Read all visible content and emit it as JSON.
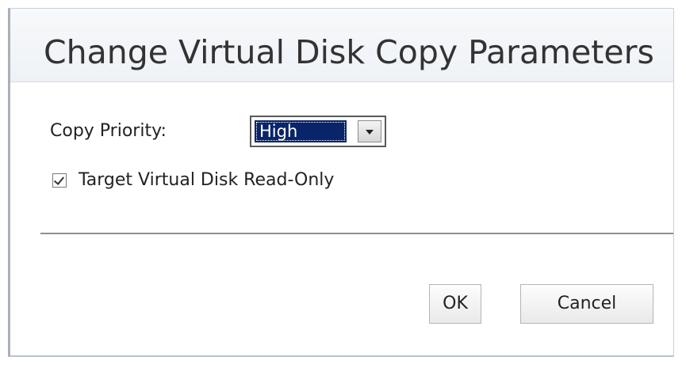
{
  "dialog": {
    "title": "Change Virtual Disk Copy Parameters"
  },
  "form": {
    "copy_priority_label": "Copy Priority:",
    "copy_priority_value": "High",
    "target_read_only_label": "Target Virtual Disk Read-Only",
    "target_read_only_checked": true
  },
  "buttons": {
    "ok_label": "OK",
    "cancel_label": "Cancel"
  },
  "icons": {
    "dropdown": "chevron-down-icon",
    "checkbox": "check-icon"
  },
  "colors": {
    "selection_highlight": "#0a246a",
    "title_bar": "#eef2f6"
  }
}
